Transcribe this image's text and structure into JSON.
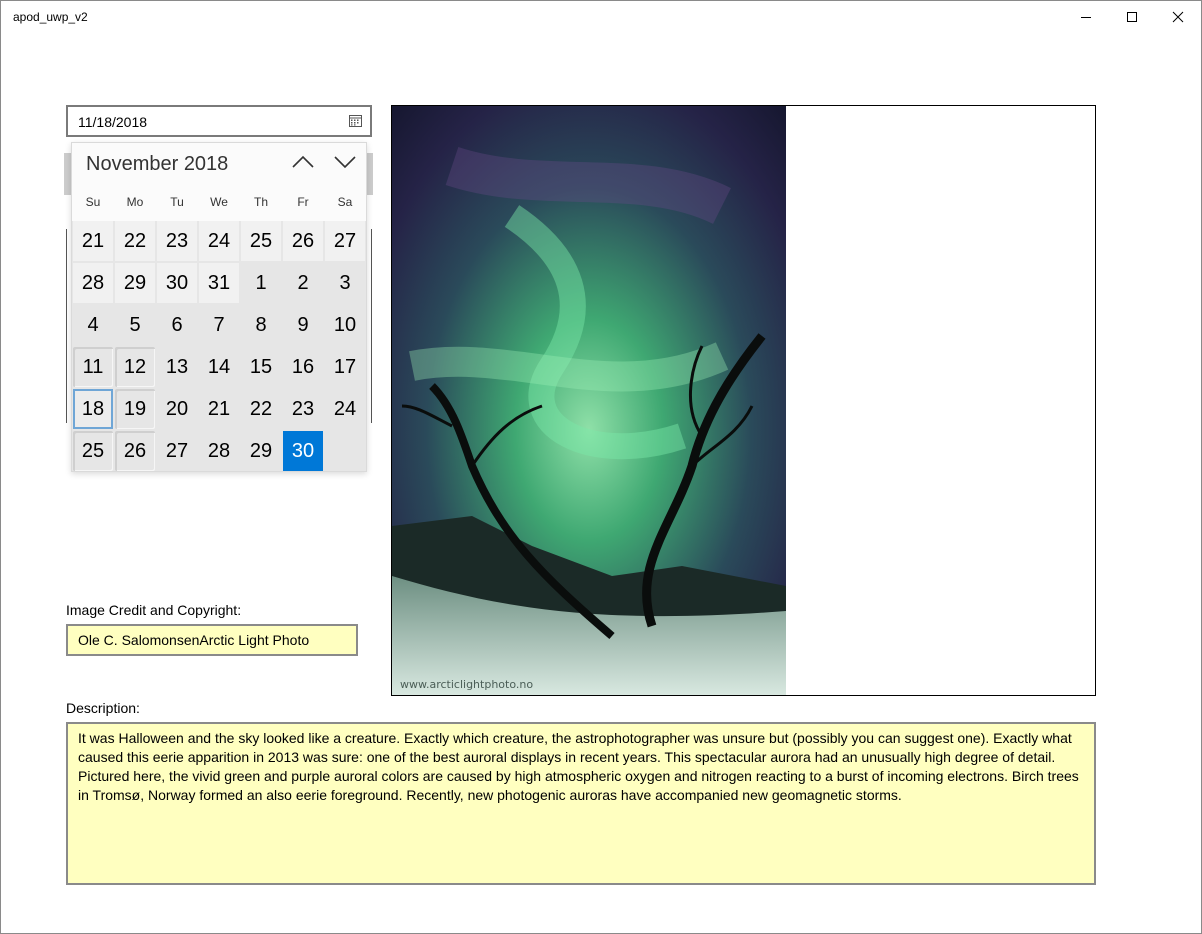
{
  "window": {
    "title": "apod_uwp_v2",
    "minimize_icon": "minimize-icon",
    "maximize_icon": "maximize-icon",
    "close_icon": "close-icon"
  },
  "date_picker": {
    "value": "11/18/2018",
    "icon": "calendar-icon"
  },
  "calendar": {
    "month_title": "November 2018",
    "prev_icon": "chevron-up-icon",
    "next_icon": "chevron-down-icon",
    "weekdays": [
      "Su",
      "Mo",
      "Tu",
      "We",
      "Th",
      "Fr",
      "Sa"
    ],
    "weeks": [
      [
        "21",
        "22",
        "23",
        "24",
        "25",
        "26",
        "27"
      ],
      [
        "28",
        "29",
        "30",
        "31",
        "1",
        "2",
        "3"
      ],
      [
        "4",
        "5",
        "6",
        "7",
        "8",
        "9",
        "10"
      ],
      [
        "11",
        "12",
        "13",
        "14",
        "15",
        "16",
        "17"
      ],
      [
        "18",
        "19",
        "20",
        "21",
        "22",
        "23",
        "24"
      ],
      [
        "25",
        "26",
        "27",
        "28",
        "29",
        "30",
        ""
      ]
    ],
    "selected_day": "30",
    "focused_day": "18",
    "accent_color": "#0078d7"
  },
  "image": {
    "watermark": "www.arcticlightphoto.no"
  },
  "credit": {
    "label": "Image Credit and Copyright:",
    "value": "Ole C. SalomonsenArctic Light Photo"
  },
  "description": {
    "label": "Description:",
    "text": "It was Halloween and the sky looked like a creature. Exactly which creature, the astrophotographer was unsure but (possibly you can suggest one). Exactly what caused this  eerie apparition in 2013 was sure: one of the best auroral displays in recent years. This spectacular aurora had an unusually high degree of detail. Pictured here, the vivid green and purple  auroral colors are caused by high atmospheric oxygen and nitrogen reacting to a burst of incoming electrons.  Birch trees in Tromsø, Norway formed an also eerie foreground. Recently, new photogenic auroras have accompanied new geomagnetic storms."
  },
  "colors": {
    "field_background": "#ffffc0",
    "field_border": "#8a8a8a"
  }
}
